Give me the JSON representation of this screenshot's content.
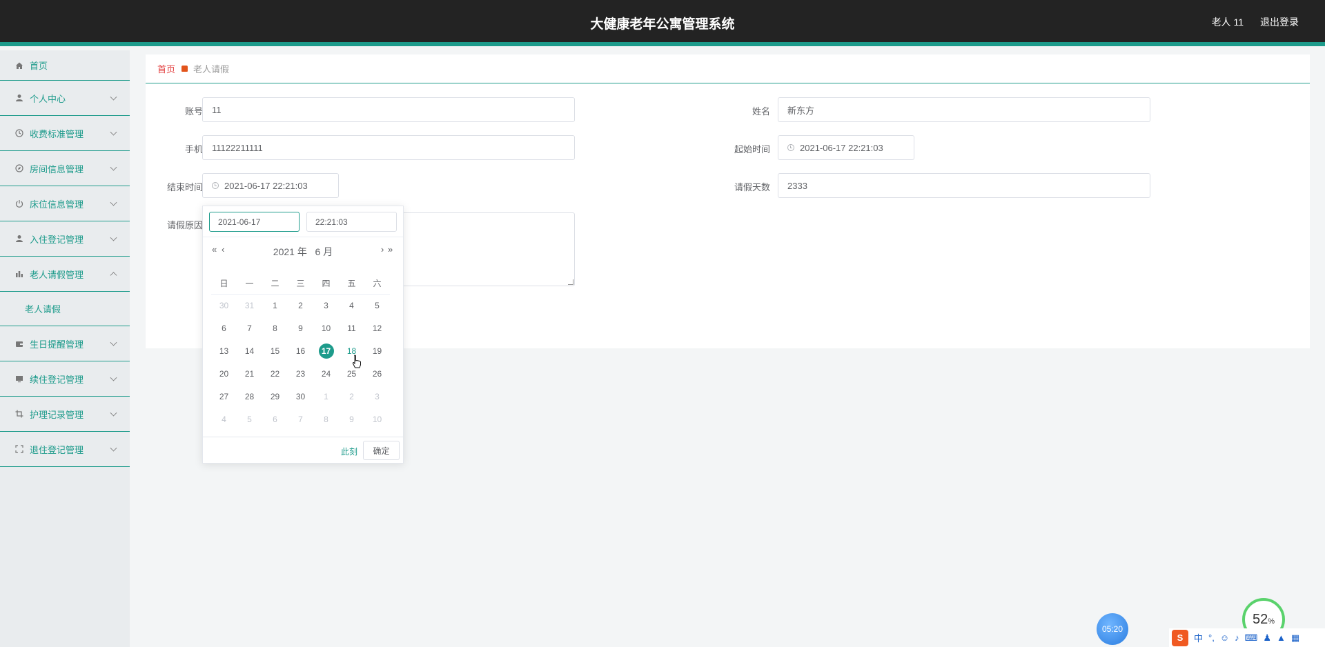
{
  "header": {
    "title": "大健康老年公寓管理系统",
    "user": "老人 11",
    "logout": "退出登录"
  },
  "sidebar": {
    "items": [
      {
        "label": "首页",
        "icon": "home-icon"
      },
      {
        "label": "个人中心",
        "icon": "user-icon"
      },
      {
        "label": "收费标准管理",
        "icon": "clock-icon"
      },
      {
        "label": "房间信息管理",
        "icon": "compass-icon"
      },
      {
        "label": "床位信息管理",
        "icon": "power-icon"
      },
      {
        "label": "入住登记管理",
        "icon": "user-icon"
      },
      {
        "label": "老人请假管理",
        "icon": "bar-chart-icon"
      },
      {
        "label": "生日提醒管理",
        "icon": "wallet-icon"
      },
      {
        "label": "续住登记管理",
        "icon": "monitor-icon"
      },
      {
        "label": "护理记录管理",
        "icon": "crop-icon"
      },
      {
        "label": "退住登记管理",
        "icon": "fullscreen-icon"
      }
    ],
    "submenu_label": "老人请假"
  },
  "breadcrumb": {
    "home": "首页",
    "current": "老人请假"
  },
  "form": {
    "account_label": "账号",
    "account_value": "11",
    "name_label": "姓名",
    "name_value": "新东方",
    "phone_label": "手机",
    "phone_value": "11122211111",
    "start_label": "起始时间",
    "start_value": "2021-06-17 22:21:03",
    "end_label": "结束时间",
    "end_value": "2021-06-17 22:21:03",
    "days_label": "请假天数",
    "days_value": "2333",
    "reason_label": "请假原因"
  },
  "datepicker": {
    "date_input": "2021-06-17",
    "time_input": "22:21:03",
    "year_label": "2021 年",
    "month_label": "6 月",
    "weekdays": [
      "日",
      "一",
      "二",
      "三",
      "四",
      "五",
      "六"
    ],
    "weeks": [
      [
        "30",
        "31",
        "1",
        "2",
        "3",
        "4",
        "5"
      ],
      [
        "6",
        "7",
        "8",
        "9",
        "10",
        "11",
        "12"
      ],
      [
        "13",
        "14",
        "15",
        "16",
        "17",
        "18",
        "19"
      ],
      [
        "20",
        "21",
        "22",
        "23",
        "24",
        "25",
        "26"
      ],
      [
        "27",
        "28",
        "29",
        "30",
        "1",
        "2",
        "3"
      ],
      [
        "4",
        "5",
        "6",
        "7",
        "8",
        "9",
        "10"
      ]
    ],
    "selected_day": "17",
    "hover_day": "18",
    "now_label": "此刻",
    "confirm_label": "确定"
  },
  "widgets": {
    "timer": "05:20",
    "percent": "52",
    "percent_unit": "%",
    "ime_logo": "S",
    "ime_lang": "中"
  },
  "colors": {
    "accent": "#1d9b8b",
    "header_bg": "#232323",
    "breadcrumb_home": "#e23b3b"
  }
}
